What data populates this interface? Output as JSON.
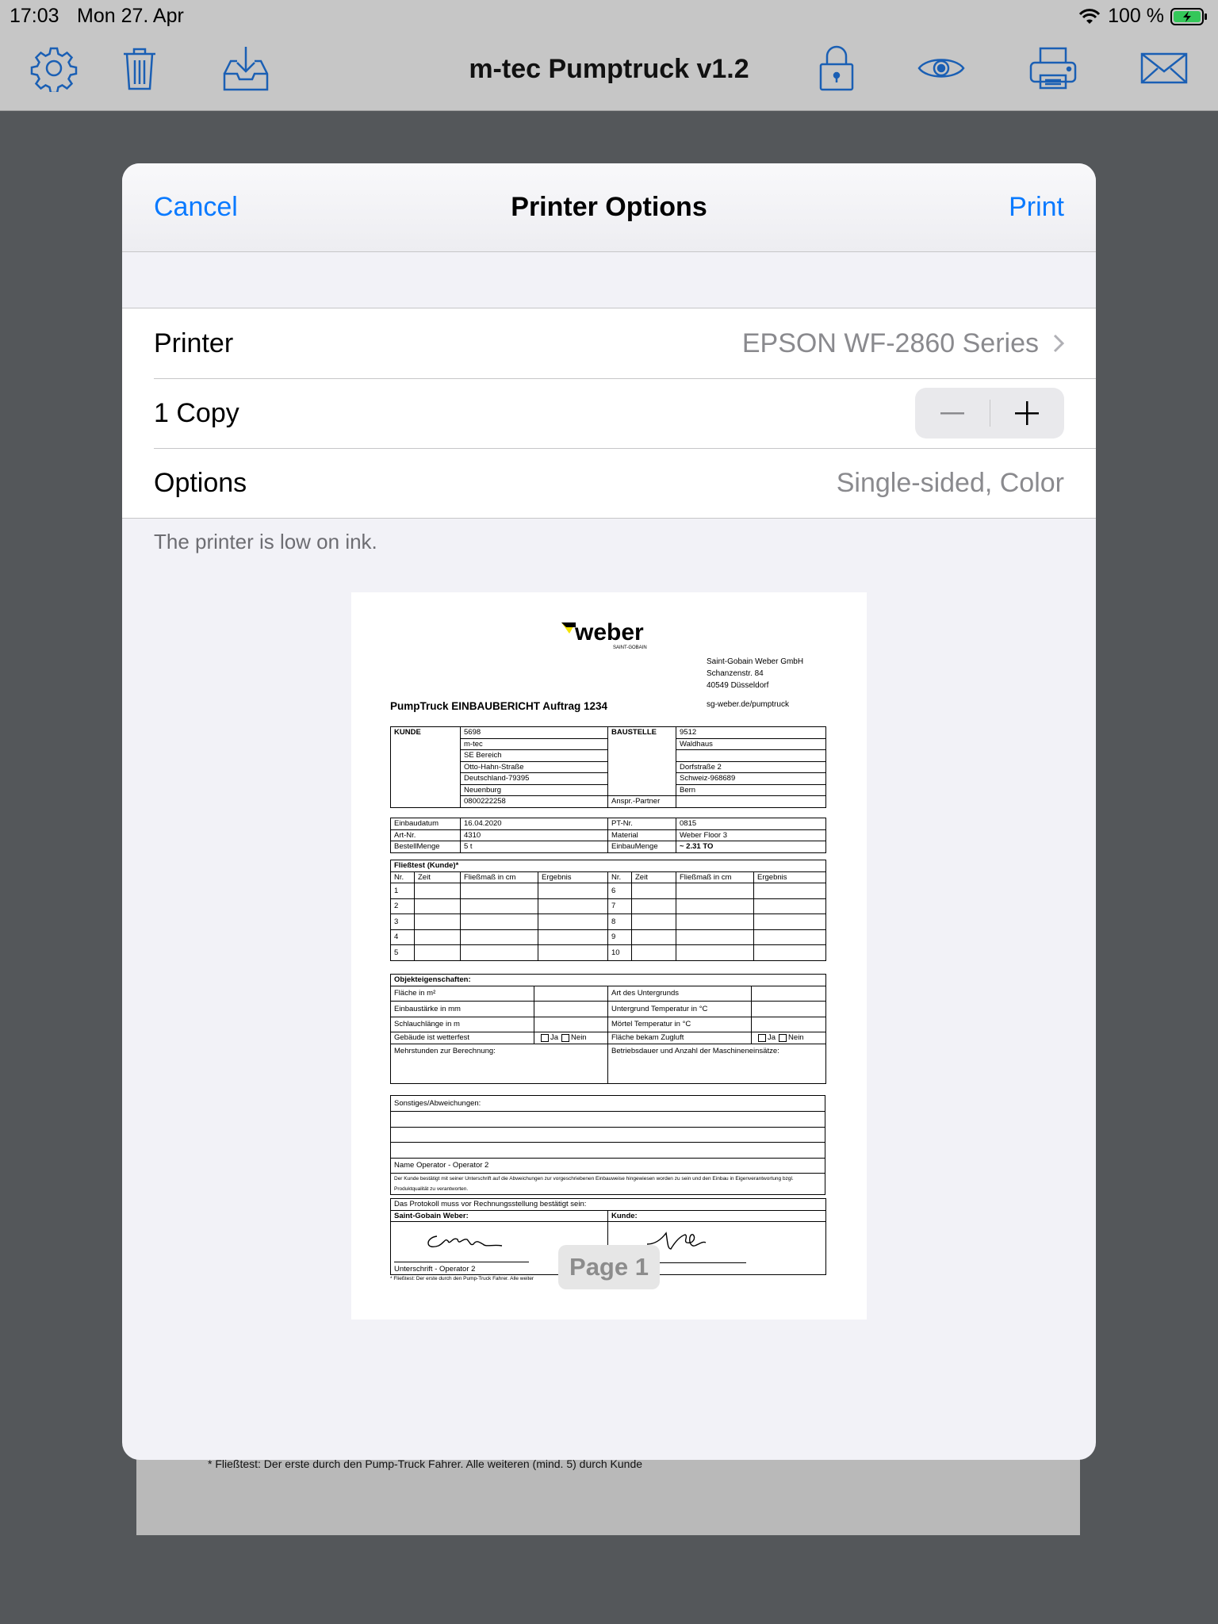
{
  "status": {
    "time": "17:03",
    "date": "Mon 27. Apr",
    "battery": "100 %"
  },
  "toolbar": {
    "title": "m-tec Pumptruck v1.2",
    "icons": [
      "gear-icon",
      "trash-icon",
      "download-tray-icon",
      "lock-icon",
      "eye-icon",
      "printer-icon",
      "mail-icon"
    ],
    "accent": "#1a5fb4"
  },
  "sheet": {
    "cancel_label": "Cancel",
    "title": "Printer Options",
    "print_label": "Print",
    "printer_label": "Printer",
    "printer_value": "EPSON WF-2860 Series",
    "copies_label": "1 Copy",
    "options_label": "Options",
    "options_value": "Single-sided, Color",
    "ink_note": "The printer is low on ink.",
    "page_badge": "Page 1"
  },
  "background": {
    "footnote": "* Fließtest: Der erste durch den Pump-Truck Fahrer. Alle weiteren (mind. 5) durch Kunde"
  },
  "doc": {
    "logo_text": "weber",
    "logo_sub": "SAINT-GOBAIN",
    "address": [
      "Saint-Gobain Weber GmbH",
      "Schanzenstr. 84",
      "40549 Düsseldorf"
    ],
    "title": "PumpTruck EINBAUBERICHT Auftrag  1234",
    "website": "sg-weber.de/pumptruck",
    "kunde_label": "KUNDE",
    "kunde": [
      "5698",
      "m-tec",
      "SE Bereich",
      "Otto-Hahn-Straße",
      "Deutschland-79395",
      "Neuenburg",
      "0800222258"
    ],
    "baustelle_label": "BAUSTELLE",
    "baustelle": [
      "9512",
      "Waldhaus",
      "",
      "Dorfstraße 2",
      "Schweiz-968689",
      "Bern"
    ],
    "ansprech_label": "Anspr.-Partner",
    "info": {
      "einbaudatum_label": "Einbaudatum",
      "einbaudatum": "16.04.2020",
      "ptnr_label": "PT-Nr.",
      "ptnr": "0815",
      "artnr_label": "Art-Nr.",
      "artnr": "4310",
      "material_label": "Material",
      "material": "Weber Floor 3",
      "bestell_label": "BestellMenge",
      "bestell": "5 t",
      "einbau_label": "EinbauMenge",
      "einbau": "~ 2.31 TO"
    },
    "fliess": {
      "title": "Fließtest (Kunde)*",
      "headers": [
        "Nr.",
        "Zeit",
        "Fließmaß in cm",
        "Ergebnis",
        "Nr.",
        "Zeit",
        "Fließmaß in cm",
        "Ergebnis"
      ],
      "left_nums": [
        "1",
        "2",
        "3",
        "4",
        "5"
      ],
      "right_nums": [
        "6",
        "7",
        "8",
        "9",
        "10"
      ]
    },
    "objekt": {
      "title": "Objekteigenschaften:",
      "flaeche": "Fläche in m²",
      "untergrund_art": "Art des Untergrunds",
      "staerke": "Einbaustärke in mm",
      "untergrund_temp": "Untergrund Temperatur in °C",
      "schlauch": "Schlauchlänge in m",
      "moertel_temp": "Mörtel Temperatur in °C",
      "wetterfest": "Gebäude ist wetterfest",
      "zugluft": "Fläche bekam Zugluft",
      "ja": "Ja",
      "nein": "Nein",
      "mehrstunden": "Mehrstunden zur Berechnung:",
      "betriebsdauer": "Betriebsdauer und Anzahl der Maschineneinsätze:"
    },
    "sonstiges": {
      "title": "Sonstiges/Abweichungen:",
      "operator": "Name Operator -  Operator 2",
      "disclaimer": "Der Kunde bestätigt mit seiner Unterschrift auf die Abweichungen zur vorgeschriebenen Einbauweise hingewiesen worden zu sein und den Einbau in Eigenverantwortung bzgl. Produktqualität zu verantworten."
    },
    "signatures": {
      "header": "Das Protokoll muss vor Rechnungsstellung bestätigt sein:",
      "weber": "Saint-Gobain Weber:",
      "kunde": "Kunde:",
      "unterschrift": "Unterschrift -  Operator 2"
    },
    "footnote": "* Fließtest: Der erste durch den Pump-Truck Fahrer. Alle weiter"
  }
}
